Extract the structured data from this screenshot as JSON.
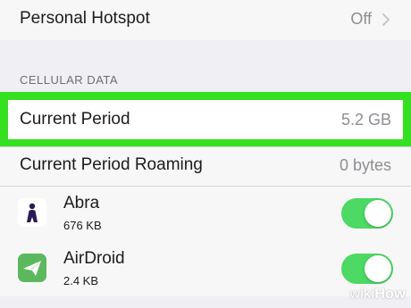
{
  "hotspot": {
    "label": "Personal Hotspot",
    "value": "Off"
  },
  "cellular_section": {
    "header": "CELLULAR DATA"
  },
  "current_period": {
    "label": "Current Period",
    "value": "5.2 GB",
    "highlight_color": "#34e020"
  },
  "roaming": {
    "label": "Current Period Roaming",
    "value": "0 bytes"
  },
  "apps": [
    {
      "name": "Abra",
      "size": "676 KB",
      "icon": "abra-app-icon",
      "enabled": true
    },
    {
      "name": "AirDroid",
      "size": "2.4 KB",
      "icon": "airdroid-app-icon",
      "enabled": true
    }
  ],
  "colors": {
    "toggle_on": "#4cd964",
    "background": "#efeff4",
    "secondary_text": "#8e8e93"
  },
  "watermark": {
    "part1": "wiki",
    "part2": "How"
  }
}
